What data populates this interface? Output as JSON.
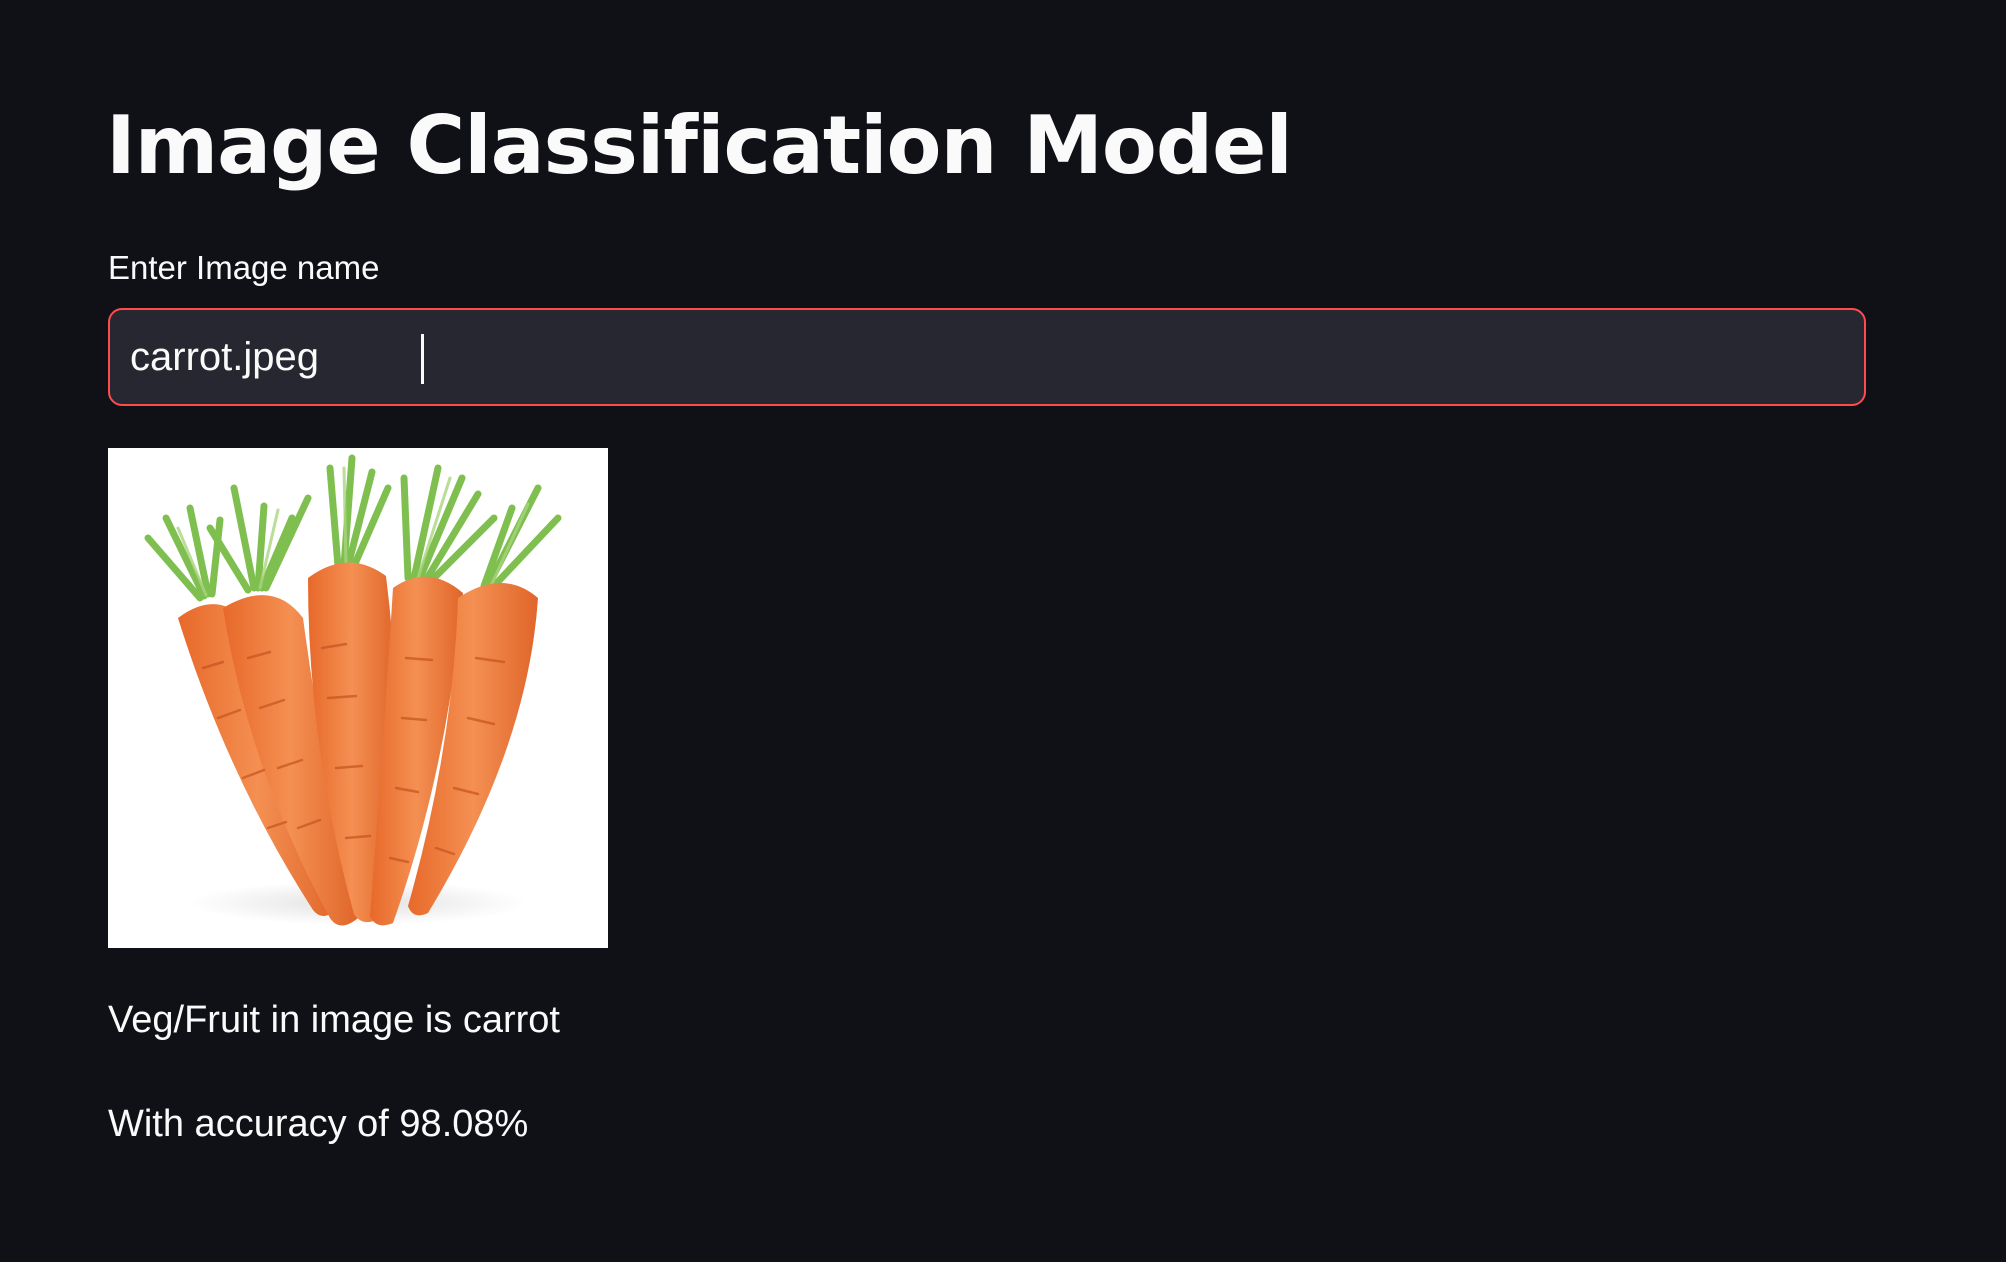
{
  "app": {
    "title": "Image Classification Model"
  },
  "form": {
    "label": "Enter Image name",
    "value": "carrot.jpeg"
  },
  "image": {
    "subject": "carrots"
  },
  "results": {
    "prediction": "Veg/Fruit in image is carrot",
    "accuracy": "With accuracy of 98.08%"
  },
  "colors": {
    "background": "#0f1117",
    "input_background": "#262730",
    "input_border_focus": "#ff4b4b",
    "text": "#fafafa",
    "carrot": "#f07a38",
    "carrot_top": "#7fbf4f"
  }
}
